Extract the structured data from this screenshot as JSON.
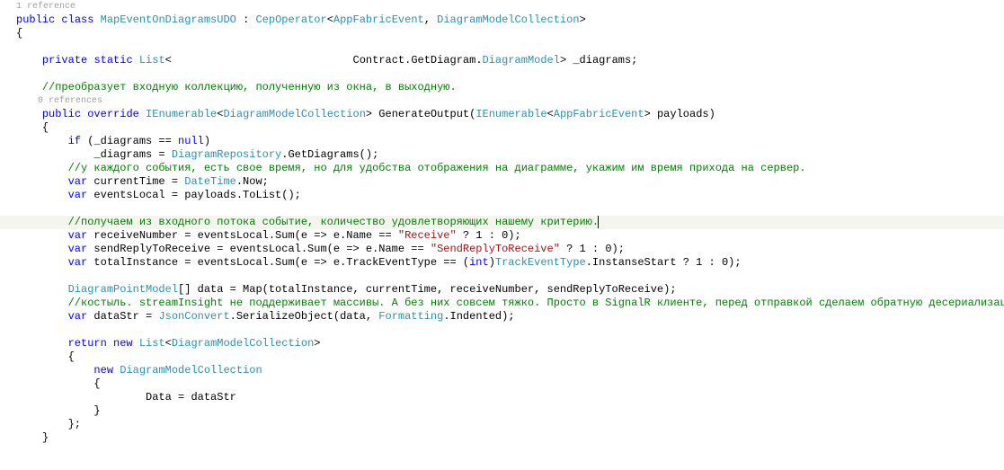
{
  "codelens": {
    "refs1": "1 reference",
    "refs0": "0 references"
  },
  "kw": {
    "public": "public",
    "class": "class",
    "private": "private",
    "static": "static",
    "override": "override",
    "if": "if",
    "null": "null",
    "var": "var",
    "new": "new",
    "return": "return",
    "int": "int"
  },
  "type": {
    "MapEventOnDiagramsUDO": "MapEventOnDiagramsUDO",
    "CepOperator": "CepOperator",
    "AppFabricEvent": "AppFabricEvent",
    "DiagramModelCollection": "DiagramModelCollection",
    "List": "List",
    "DiagramModel": "DiagramModel",
    "IEnumerable": "IEnumerable",
    "DiagramRepository": "DiagramRepository",
    "DateTime": "DateTime",
    "DiagramPointModel": "DiagramPointModel",
    "TrackEventType": "TrackEventType",
    "JsonConvert": "JsonConvert",
    "Formatting": "Formatting"
  },
  "txt": {
    "colon": " : ",
    "lt": "<",
    "gt": ">",
    "comma": ", ",
    "obrace": "{",
    "cbrace": "}",
    "cbraceSemi": "};",
    "contractGetDiagram": "                            Contract.GetDiagram.",
    "diagramsField": "> _diagrams;",
    "generateOutput": "> GenerateOutput(",
    "payloads": "> payloads)",
    "ifOpen": " (_diagrams == ",
    "ifClose": ")",
    "diagramsAssign": "    _diagrams = ",
    "getDiagrams": ".GetDiagrams();",
    "currentTime": " currentTime = ",
    "now": ".Now;",
    "eventsLocal": " eventsLocal = payloads.ToList();",
    "receiveNumber": " receiveNumber = eventsLocal.Sum(e => e.Name == ",
    "sendReply": " sendReplyToReceive = eventsLocal.Sum(e => e.Name == ",
    "totalInstance": " totalInstance = eventsLocal.Sum(e => e.TrackEventType == (",
    "ternary": " ? 1 : 0);",
    "castClose": ")",
    "instanseStart": ".InstanseStart ? 1 : 0);",
    "dataArr": "[] data = Map(totalInstance, currentTime, receiveNumber, sendReplyToReceive);",
    "dataStr": " dataStr = ",
    "serialize": ".SerializeObject(data, ",
    "indented": ".Indented);",
    "returnNew": " ",
    "dataAssign": "        Data = dataStr"
  },
  "cmt": {
    "c1": "//преобразует входную коллекцию, полученную из окна, в выходную.",
    "c2": "//у каждого события, есть свое время, но для удобства отображения на диаграмме, укажим им время прихода на сервер.",
    "c3": "//получаем из входного потока событие, количество удовлетворяющих нашему критерию.",
    "c4": "//костыль. streamInsight не поддерживает массивы. А без них совсем тяжко. Просто в SignalR клиенте, перед отправкой сделаем обратную десериализацию."
  },
  "str": {
    "receive": "\"Receive\"",
    "sendReply": "\"SendReplyToReceive\""
  },
  "indent": {
    "i0": "",
    "i1": "    ",
    "i2": "        ",
    "i3": "            "
  }
}
